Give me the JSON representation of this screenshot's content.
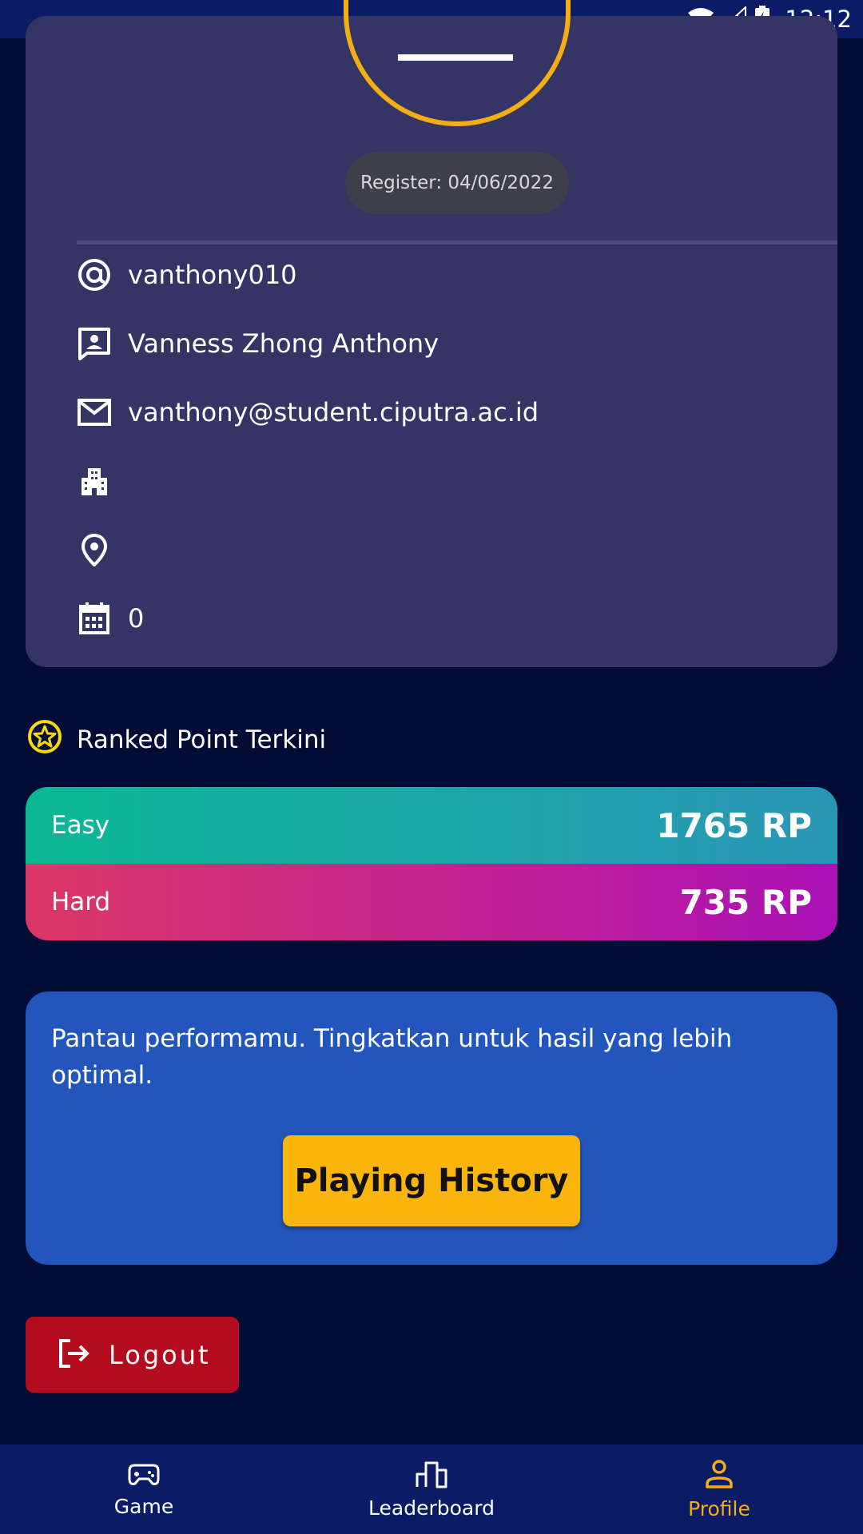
{
  "status_bar": {
    "time": "12:12",
    "icons": [
      "wifi-icon",
      "signal-icon",
      "battery-charging-icon"
    ]
  },
  "profile": {
    "register_label": "Register: 04/06/2022",
    "rows": [
      {
        "icon": "at-icon",
        "text": "vanthony010"
      },
      {
        "icon": "contact-card-icon",
        "text": "Vanness Zhong Anthony"
      },
      {
        "icon": "mail-icon",
        "text": "vanthony@student.ciputra.ac.id"
      },
      {
        "icon": "building-icon",
        "text": ""
      },
      {
        "icon": "location-pin-icon",
        "text": ""
      },
      {
        "icon": "calendar-icon",
        "text": "0"
      }
    ]
  },
  "ranked": {
    "title": "Ranked Point Terkini",
    "icon": "star-badge-icon",
    "easy": {
      "label": "Easy",
      "value": "1765 RP"
    },
    "hard": {
      "label": "Hard",
      "value": "735 RP"
    }
  },
  "performance": {
    "text": "Pantau performamu. Tingkatkan untuk hasil yang lebih optimal.",
    "button_label": "Playing History"
  },
  "logout": {
    "label": "Logout"
  },
  "bottom_nav": {
    "items": [
      {
        "label": "Game",
        "icon": "gamepad-icon"
      },
      {
        "label": "Leaderboard",
        "icon": "leaderboard-icon"
      },
      {
        "label": "Profile",
        "icon": "profile-icon"
      }
    ],
    "active_index": 2
  },
  "colors": {
    "background": "#020c34",
    "card": "#353565",
    "accent": "#fbb50c",
    "active_nav": "#f4ad12",
    "logout": "#b50b1f",
    "perf_card": "#2356bd"
  }
}
